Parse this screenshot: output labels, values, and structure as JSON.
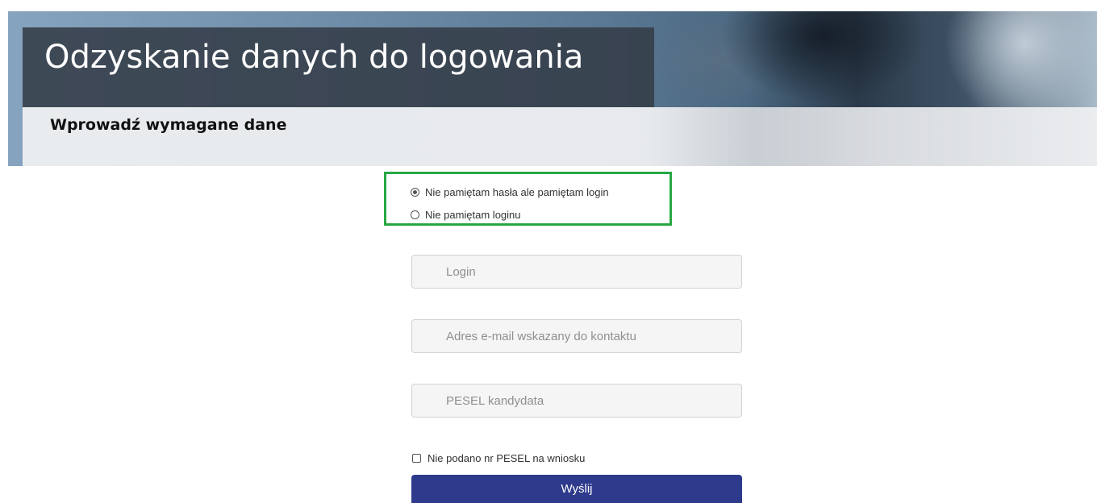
{
  "header": {
    "title": "Odzyskanie danych do logowania",
    "subtitle": "Wprowadź wymagane dane"
  },
  "recovery_options": [
    {
      "label": "Nie pamiętam hasła ale pamiętam login",
      "selected": true
    },
    {
      "label": "Nie pamiętam loginu",
      "selected": false
    }
  ],
  "form": {
    "login_placeholder": "Login",
    "email_placeholder": "Adres e-mail wskazany do kontaktu",
    "pesel_placeholder": "PESEL kandydata",
    "no_pesel_label": "Nie podano nr PESEL na wniosku",
    "no_pesel_checked": false,
    "submit_label": "Wyślij"
  },
  "colors": {
    "highlight": "#27a844",
    "button": "#2e3a8c"
  }
}
